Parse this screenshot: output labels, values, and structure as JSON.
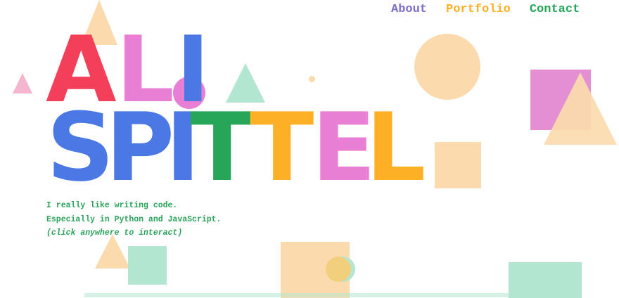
{
  "nav": {
    "about": "About",
    "portfolio": "Portfolio",
    "contact": "Contact"
  },
  "hero": {
    "line1": [
      "A",
      "L",
      "I"
    ],
    "line2": [
      "S",
      "P",
      "I",
      "T",
      "T",
      "E",
      "L"
    ]
  },
  "tagline": {
    "line1": "I really like writing code.",
    "line2": "Especially in Python and JavaScript.",
    "hint": "(click anywhere to interact)"
  },
  "colors": {
    "red": "#f33f59",
    "pink": "#e97ed5",
    "blue": "#4a78e4",
    "green": "#27a65a",
    "orange": "#fdb026",
    "peach": "#fbdbad",
    "mint": "#b3e6d1",
    "purple": "#7c6dd3"
  }
}
